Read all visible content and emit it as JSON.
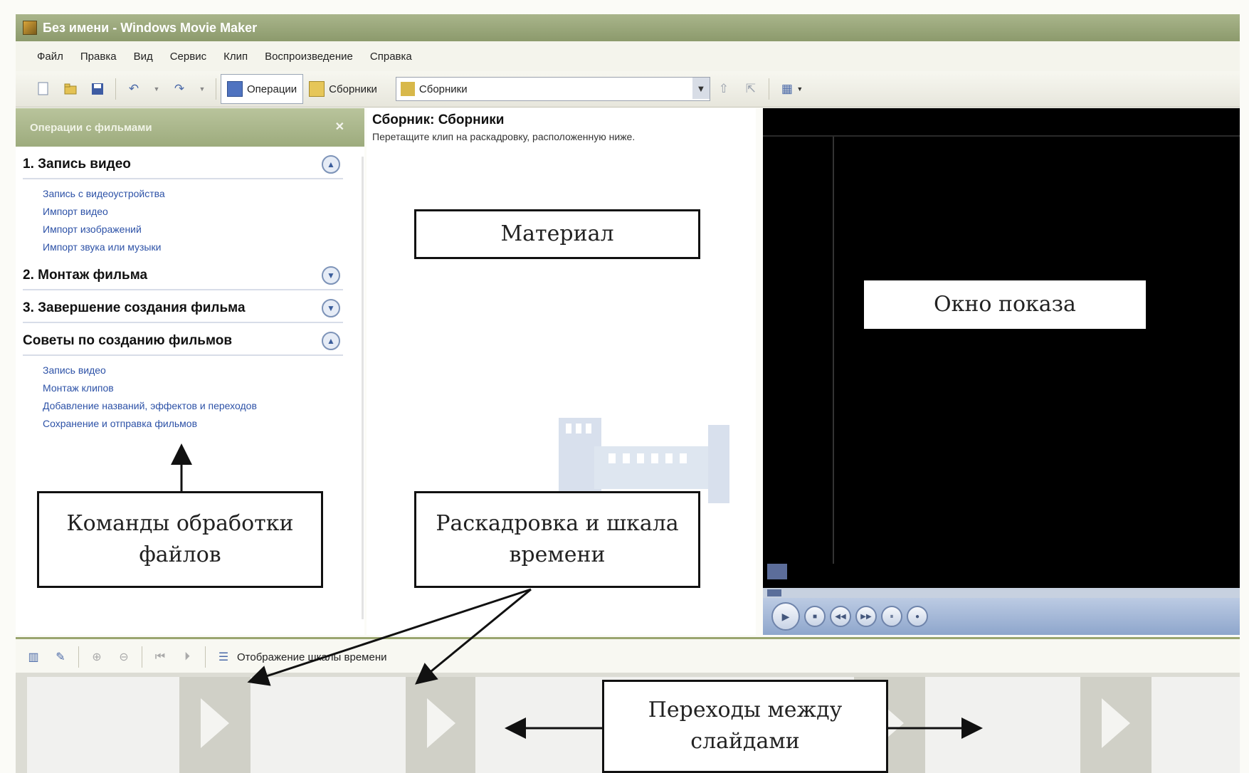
{
  "window": {
    "title": "Без имени - Windows Movie Maker"
  },
  "menu": [
    "Файл",
    "Правка",
    "Вид",
    "Сервис",
    "Клип",
    "Воспроизведение",
    "Справка"
  ],
  "toolbar": {
    "operations_label": "Операции",
    "collections_label": "Сборники",
    "collection_select_value": "Сборники"
  },
  "tasks": {
    "header": "Операции с фильмами",
    "sections": [
      {
        "title": "1. Запись видео",
        "expanded": true,
        "links": [
          "Запись с видеоустройства",
          "Импорт видео",
          "Импорт изображений",
          "Импорт звука или музыки"
        ]
      },
      {
        "title": "2. Монтаж фильма",
        "expanded": false,
        "links": []
      },
      {
        "title": "3. Завершение создания фильма",
        "expanded": false,
        "links": []
      },
      {
        "title": "Советы по созданию фильмов",
        "expanded": true,
        "links": [
          "Запись видео",
          "Монтаж клипов",
          "Добавление названий, эффектов и переходов",
          "Сохранение и отправка фильмов"
        ]
      }
    ]
  },
  "collection": {
    "title": "Сборник: Сборники",
    "hint": "Перетащите клип на раскадровку, расположенную ниже."
  },
  "storyboard": {
    "show_timeline_label": "Отображение шкалы времени"
  },
  "callouts": {
    "material": "Материал",
    "preview": "Окно показа",
    "commands_line1": "Команды обработки",
    "commands_line2": "файлов",
    "storyboard_line1": "Раскадровка и шкала",
    "storyboard_line2": "времени",
    "transitions_line1": "Переходы между",
    "transitions_line2": "слайдами"
  },
  "icons": {
    "new": "new-file-icon",
    "open": "open-folder-icon",
    "save": "save-disk-icon",
    "undo": "undo-icon",
    "redo": "redo-icon",
    "play": "play-icon",
    "stop": "stop-icon"
  },
  "colors": {
    "titlebar": "#9aa67a",
    "link": "#2d52a7",
    "preview_bg": "#000000"
  }
}
